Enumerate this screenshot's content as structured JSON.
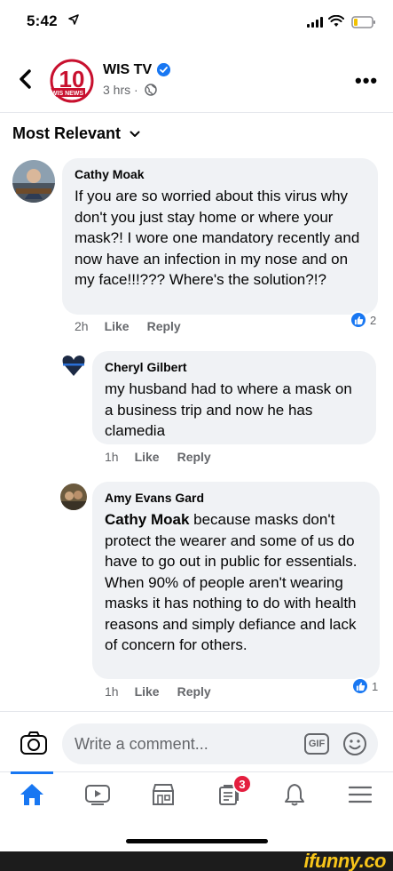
{
  "status_bar": {
    "time": "5:42"
  },
  "post": {
    "page_name": "WIS TV",
    "logo_text": "10",
    "logo_subtext": "WIS NEWS",
    "meta": "3 hrs ·"
  },
  "sort": {
    "label": "Most Relevant"
  },
  "comments": [
    {
      "author": "Cathy Moak",
      "text": "If you are so worried about this virus why don't you just stay home or where your mask?! I wore one mandatory recently and now have an infection in my nose and on my face!!!??? Where's the solution?!?",
      "time": "2h",
      "like": "Like",
      "reply": "Reply",
      "reactions": "2"
    },
    {
      "author": "Cheryl Gilbert",
      "text": "my husband had to where a mask on a business trip and now he has clamedia",
      "time": "1h",
      "like": "Like",
      "reply": "Reply"
    },
    {
      "author": "Amy Evans Gard",
      "mention": "Cathy Moak",
      "text": " because masks don't protect the wearer and some of us do have to go out in public for essentials. When 90% of people aren't wearing masks it has nothing to do with health reasons and simply defiance and lack of concern for others.",
      "time": "1h",
      "like": "Like",
      "reply": "Reply",
      "reactions": "1"
    }
  ],
  "composer": {
    "placeholder": "Write a comment...",
    "gif": "GIF"
  },
  "tabbar": {
    "items": [
      "home-icon",
      "watch-icon",
      "marketplace-icon",
      "notifications-icon",
      "bell-icon",
      "menu-icon"
    ],
    "notification_count": "3"
  },
  "watermark": "ifunny.co",
  "colors": {
    "accent": "#1877f2",
    "bubble": "#f0f2f5",
    "badge": "#e41e3f",
    "watermark": "#f7c51a"
  }
}
